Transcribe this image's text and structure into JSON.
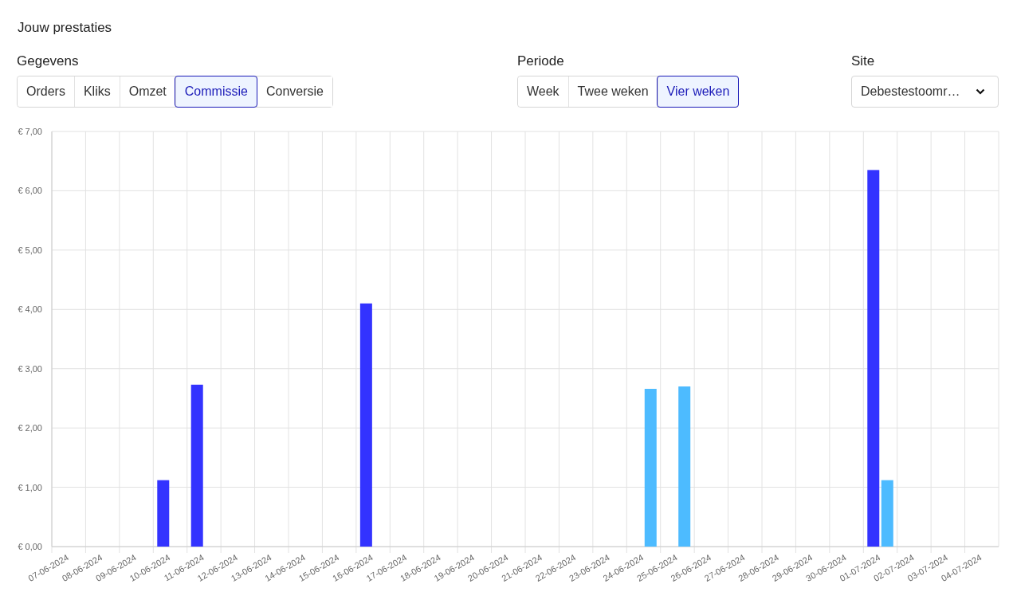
{
  "title": "Jouw prestaties",
  "data_filter": {
    "label": "Gegevens",
    "options": [
      {
        "label": "Orders",
        "selected": false
      },
      {
        "label": "Kliks",
        "selected": false
      },
      {
        "label": "Omzet",
        "selected": false
      },
      {
        "label": "Commissie",
        "selected": true
      },
      {
        "label": "Conversie",
        "selected": false
      }
    ]
  },
  "period_filter": {
    "label": "Periode",
    "options": [
      {
        "label": "Week",
        "selected": false
      },
      {
        "label": "Twee weken",
        "selected": false
      },
      {
        "label": "Vier weken",
        "selected": true
      }
    ]
  },
  "site": {
    "label": "Site",
    "value": "Debestestoomr…"
  },
  "chart_data": {
    "type": "bar",
    "categories": [
      "07-06-2024",
      "08-06-2024",
      "09-06-2024",
      "10-06-2024",
      "11-06-2024",
      "12-06-2024",
      "13-06-2024",
      "14-06-2024",
      "15-06-2024",
      "16-06-2024",
      "17-06-2024",
      "18-06-2024",
      "19-06-2024",
      "20-06-2024",
      "21-06-2024",
      "22-06-2024",
      "23-06-2024",
      "24-06-2024",
      "25-06-2024",
      "26-06-2024",
      "27-06-2024",
      "28-06-2024",
      "29-06-2024",
      "30-06-2024",
      "01-07-2024",
      "02-07-2024",
      "03-07-2024",
      "04-07-2024"
    ],
    "series": [
      {
        "color": "#3333ff",
        "values": [
          null,
          null,
          null,
          1.12,
          2.73,
          null,
          null,
          null,
          null,
          4.1,
          null,
          null,
          null,
          null,
          null,
          null,
          null,
          null,
          null,
          null,
          null,
          null,
          null,
          null,
          6.35,
          null,
          null,
          null
        ]
      },
      {
        "color": "#4dbbff",
        "values": [
          null,
          null,
          null,
          null,
          null,
          null,
          null,
          null,
          null,
          null,
          null,
          null,
          null,
          null,
          null,
          null,
          null,
          2.66,
          2.7,
          null,
          null,
          null,
          null,
          null,
          1.12,
          null,
          null,
          null
        ]
      }
    ],
    "ylim": [
      0,
      7
    ],
    "yticks": [
      {
        "value": 0,
        "label": "€ 0,00"
      },
      {
        "value": 1,
        "label": "€ 1,00"
      },
      {
        "value": 2,
        "label": "€ 2,00"
      },
      {
        "value": 3,
        "label": "€ 3,00"
      },
      {
        "value": 4,
        "label": "€ 4,00"
      },
      {
        "value": 5,
        "label": "€ 5,00"
      },
      {
        "value": 6,
        "label": "€ 6,00"
      },
      {
        "value": 7,
        "label": "€ 7,00"
      }
    ],
    "grid": true
  }
}
